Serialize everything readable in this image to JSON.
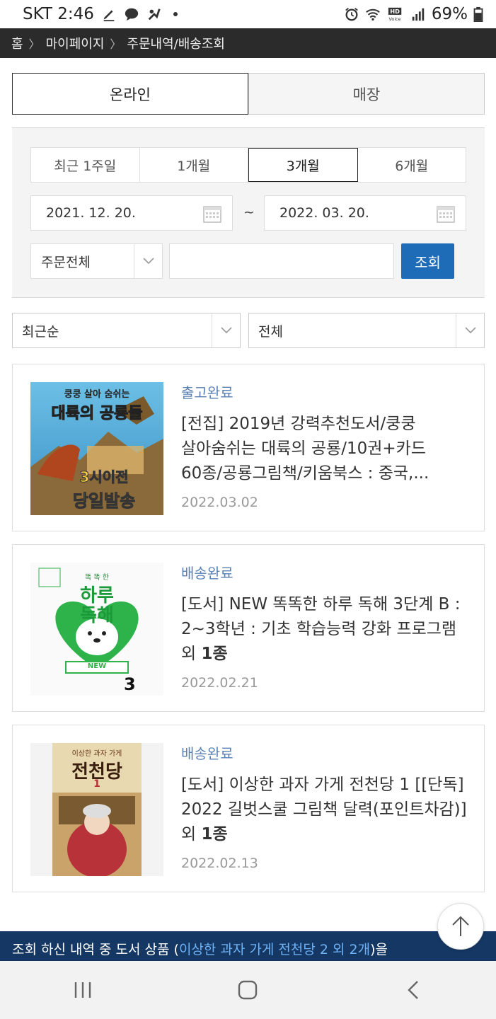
{
  "status_bar": {
    "carrier_time": "SKT 2:46",
    "battery": "69%"
  },
  "breadcrumb": {
    "home": "홈",
    "mypage": "마이페이지",
    "current": "주문내역/배송조회"
  },
  "tabs": [
    {
      "label": "온라인"
    },
    {
      "label": "매장"
    }
  ],
  "periods": [
    {
      "label": "최근 1주일"
    },
    {
      "label": "1개월"
    },
    {
      "label": "3개월"
    },
    {
      "label": "6개월"
    }
  ],
  "date_range": {
    "start": "2021. 12. 20.",
    "separator": "~",
    "end": "2022. 03. 20."
  },
  "order_filter": {
    "selected": "주문전체"
  },
  "search": {
    "placeholder": "",
    "button_label": "조회"
  },
  "sort": {
    "order": "최근순",
    "type": "전체"
  },
  "orders": [
    {
      "status": "출고완료",
      "title": "[전집] 2019년 강력추천도서/쿵쿵 살아숨쉬는 대륙의 공룡/10권+카드 60종/공룡그림책/키움북스 : 중국,...",
      "extra": "",
      "date": "2022.03.02",
      "cover_text": {
        "top": "쿵쿵 살아 숨쉬는",
        "main": "대륙의 공룡들",
        "badge1": "3시이전",
        "badge2": "당일발송"
      }
    },
    {
      "status": "배송완료",
      "title": "[도서] NEW 똑똑한 하루 독해 3단계 B : 2~3학년 : 기초 학습능력 강화 프로그램 외 ",
      "extra": "1종",
      "date": "2022.02.21",
      "cover_text": {
        "top": "똑 똑 한",
        "main1": "하루",
        "main2": "독해",
        "ribbon": "NEW",
        "level": "3"
      }
    },
    {
      "status": "배송완료",
      "title": "[도서] 이상한 과자 가게 전천당 1 [[단독] 2022 길벗스쿨 그림책 달력(포인트차감)] 외 ",
      "extra": "1종",
      "date": "2022.02.13",
      "cover_text": {
        "top": "이상한 과자 가게",
        "main": "전천당",
        "vol": "1"
      }
    }
  ],
  "banner": {
    "prefix": "조회 하신 내역 중 도서 상품 (",
    "highlight": "이상한 과자 가게 전천당 2 외 2개",
    "suffix": ")을"
  },
  "colors": {
    "accent": "#1e6bb8",
    "status": "#5b82b4",
    "banner_bg": "#143763",
    "breadcrumb_bg": "#2b2b2b"
  }
}
